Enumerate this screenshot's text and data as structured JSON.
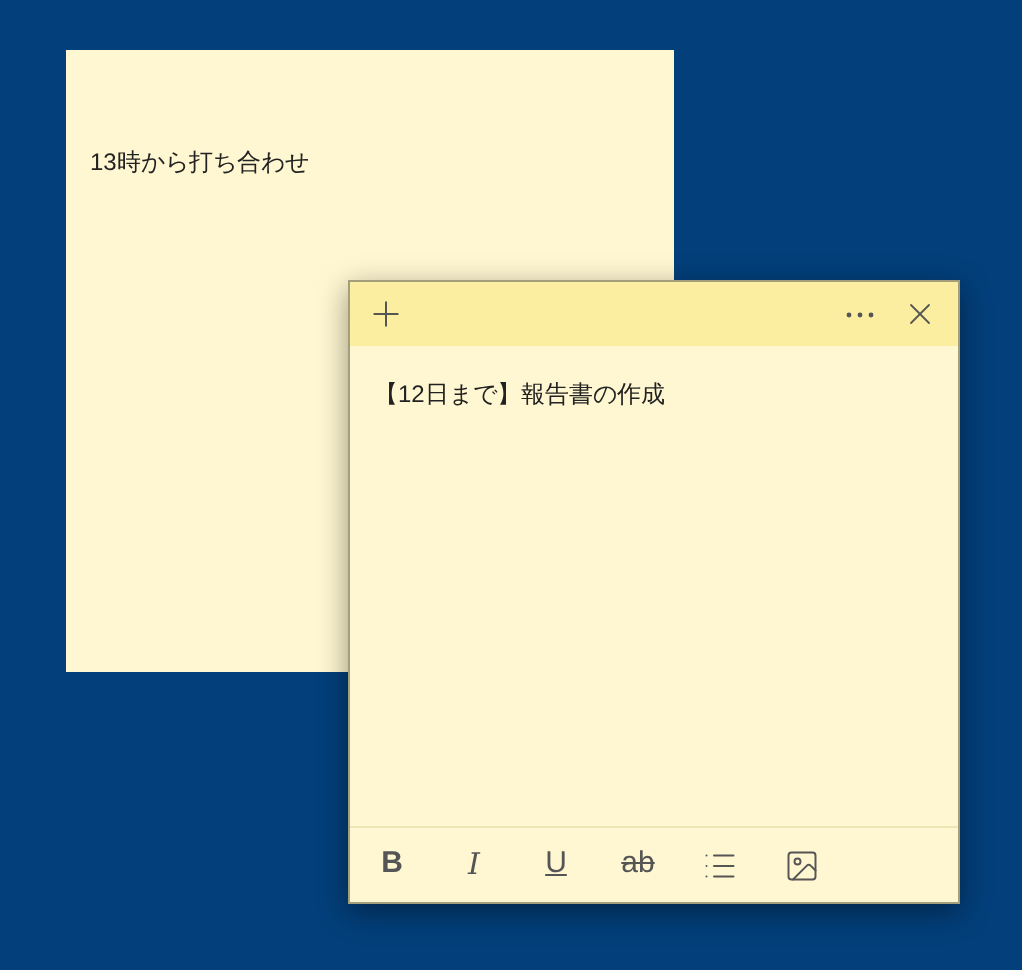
{
  "notes": [
    {
      "text": "13時から打ち合わせ",
      "active": false
    },
    {
      "text": "【12日まで】報告書の作成",
      "active": true,
      "toolbar": [
        {
          "kind": "bold",
          "label": "B"
        },
        {
          "kind": "italic",
          "label": "I"
        },
        {
          "kind": "underline",
          "label": "U"
        },
        {
          "kind": "strike",
          "label": "ab"
        },
        {
          "kind": "list"
        },
        {
          "kind": "image"
        }
      ]
    }
  ]
}
